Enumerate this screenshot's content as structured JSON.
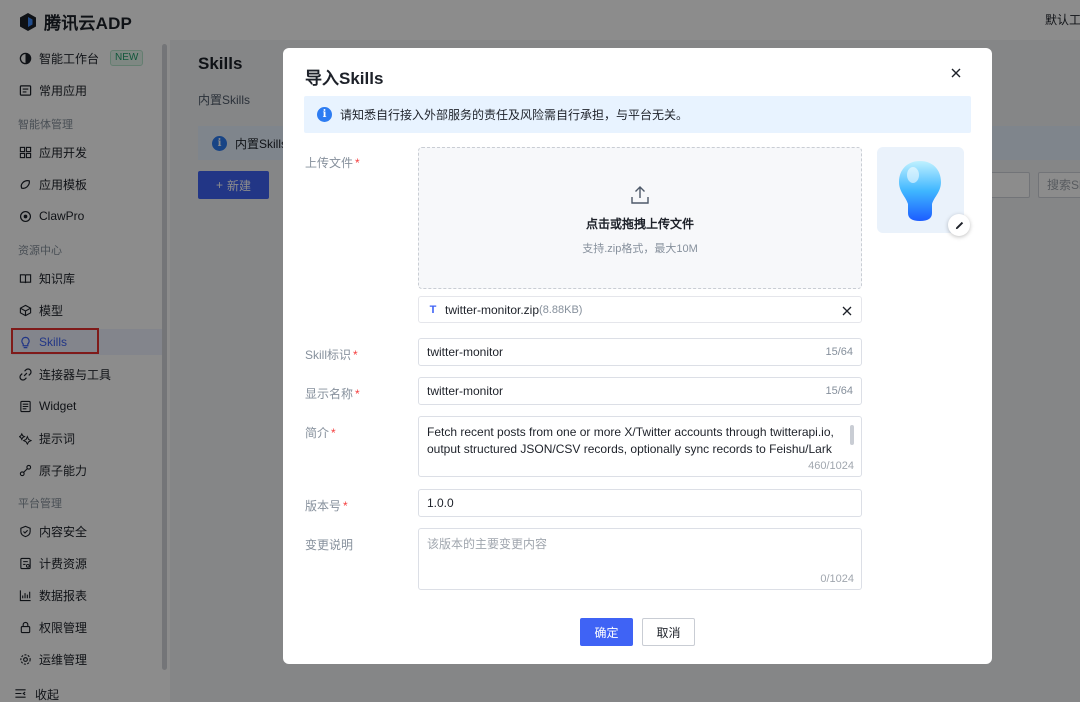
{
  "app": {
    "logo_text": "腾讯云ADP",
    "top_right_label": "默认工"
  },
  "sidebar": {
    "items": [
      {
        "label": "智能工作台",
        "badge": "NEW",
        "icon": "workbench-icon"
      },
      {
        "label": "常用应用",
        "icon": "apps-icon"
      },
      {
        "section": "智能体管理"
      },
      {
        "label": "应用开发",
        "icon": "grid-icon"
      },
      {
        "label": "应用模板",
        "icon": "template-icon"
      },
      {
        "label": "ClawPro",
        "icon": "claw-icon"
      },
      {
        "section": "资源中心"
      },
      {
        "label": "知识库",
        "icon": "book-icon"
      },
      {
        "label": "模型",
        "icon": "cube-icon"
      },
      {
        "label": "Skills",
        "icon": "bulb-icon",
        "active": true
      },
      {
        "label": "连接器与工具",
        "icon": "link-icon"
      },
      {
        "label": "Widget",
        "icon": "widget-icon"
      },
      {
        "label": "提示词",
        "icon": "sparkle-icon"
      },
      {
        "label": "原子能力",
        "icon": "atom-icon"
      },
      {
        "section": "平台管理"
      },
      {
        "label": "内容安全",
        "icon": "shield-icon"
      },
      {
        "label": "计费资源",
        "icon": "billing-icon"
      },
      {
        "label": "数据报表",
        "icon": "chart-icon"
      },
      {
        "label": "权限管理",
        "icon": "lock-icon"
      },
      {
        "label": "运维管理",
        "icon": "gear-icon"
      }
    ],
    "collapse_label": "收起"
  },
  "main": {
    "title": "Skills",
    "tab_builtin": "内置Skills",
    "notice_text": "内置Skills",
    "new_button": "新建",
    "search_placeholder": "搜索Sk"
  },
  "modal": {
    "title": "导入Skills",
    "alert_text": "请知悉自行接入外部服务的责任及风险需自行承担，与平台无关。",
    "upload": {
      "label": "上传文件",
      "main_text": "点击或拖拽上传文件",
      "hint_text": "支持.zip格式，最大10M"
    },
    "file": {
      "name": "twitter-monitor.zip",
      "size": "(8.88KB)"
    },
    "fields": {
      "skill_id": {
        "label": "Skill标识",
        "value": "twitter-monitor",
        "counter": "15/64"
      },
      "display_name": {
        "label": "显示名称",
        "value": "twitter-monitor",
        "counter": "15/64"
      },
      "intro": {
        "label": "简介",
        "value": "Fetch recent posts from one or more X/Twitter accounts through twitterapi.io, output structured JSON/CSV records, optionally sync records to Feishu/Lark",
        "counter": "460/1024"
      },
      "version": {
        "label": "版本号",
        "value": "1.0.0"
      },
      "changelog": {
        "label": "变更说明",
        "placeholder": "该版本的主要变更内容",
        "counter": "0/1024"
      }
    },
    "required_mark": "*",
    "ok_button": "确定",
    "cancel_button": "取消"
  },
  "colors": {
    "primary": "#3f63f5",
    "alert_bg": "#e8f3ff",
    "required": "#f53f3f",
    "highlight_box": "#e8302e"
  }
}
